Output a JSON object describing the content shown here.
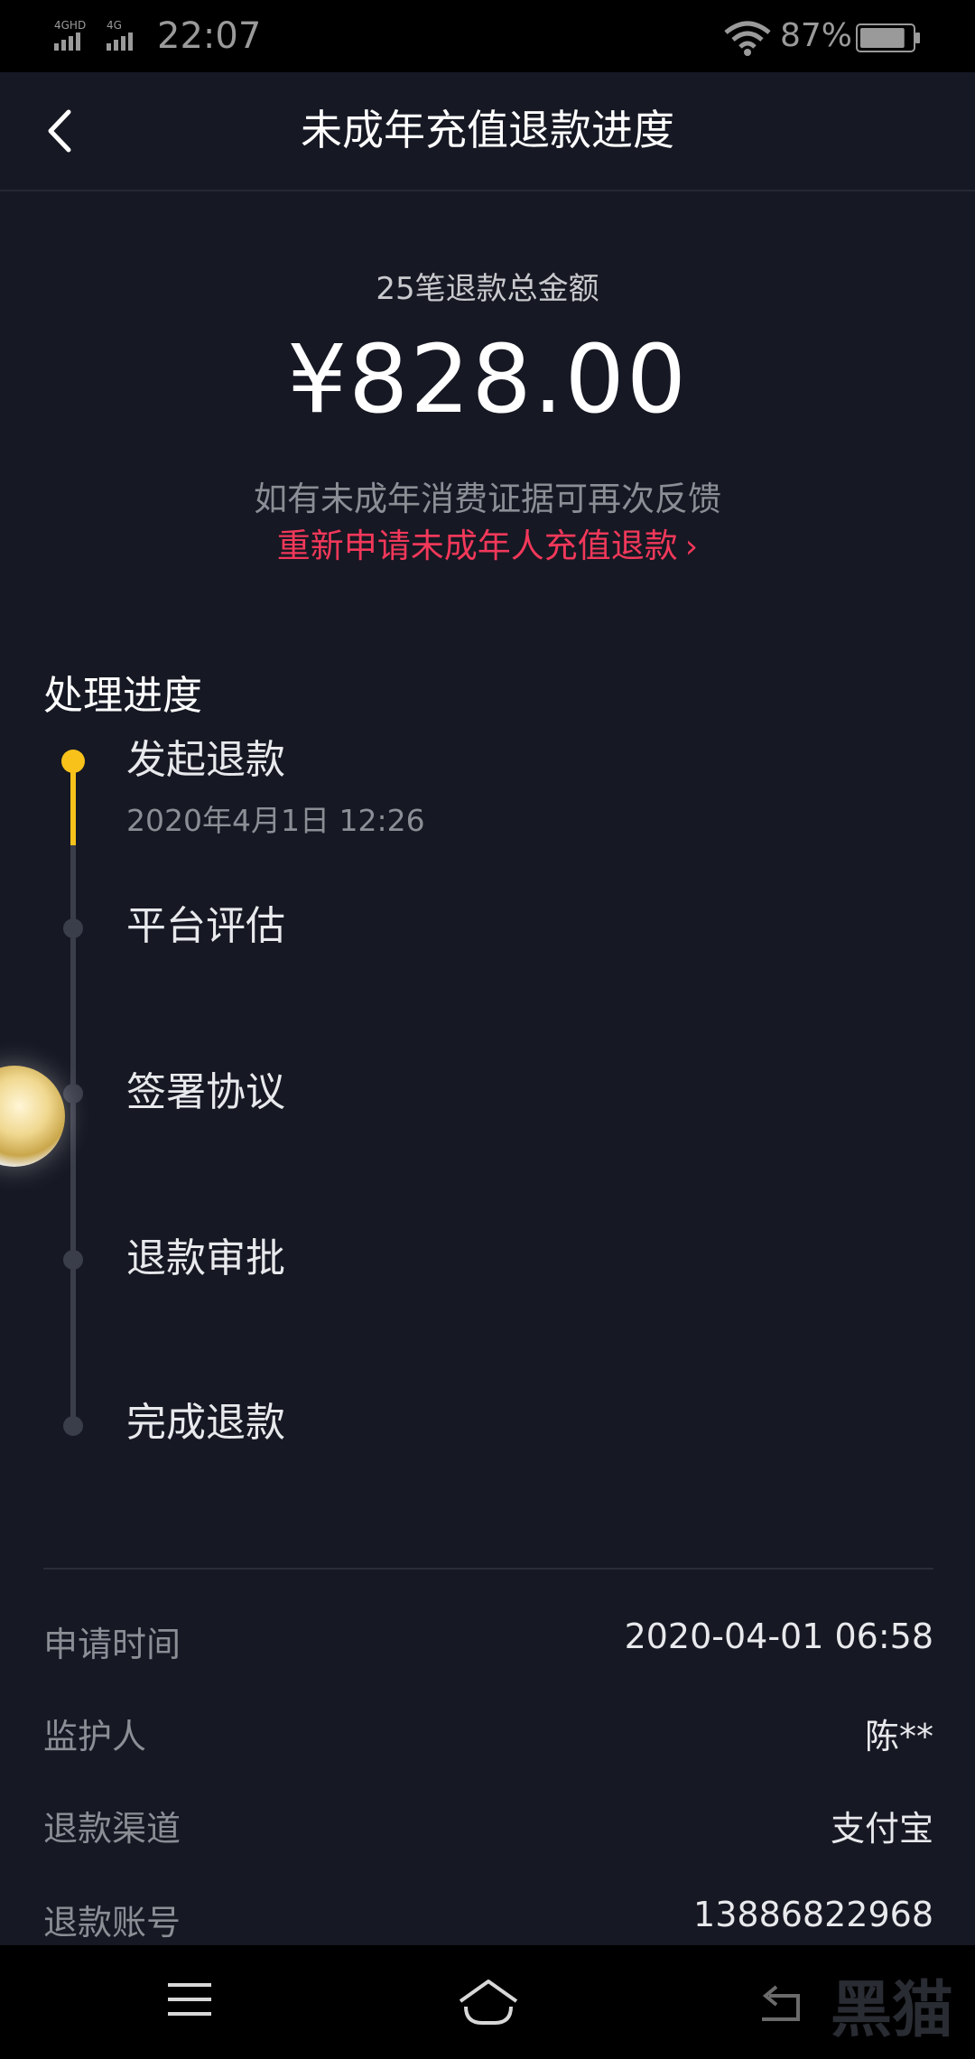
{
  "status_bar": {
    "network1": "4GHD",
    "network2": "4G",
    "time": "22:07",
    "battery_percent": "87%",
    "battery_level": 0.87
  },
  "header": {
    "title": "未成年充值退款进度",
    "back_icon": "chevron-left-icon"
  },
  "summary": {
    "label": "25笔退款总金额",
    "amount": "¥828.00",
    "note": "如有未成年消费证据可再次反馈",
    "reapply_link": "重新申请未成年人充值退款",
    "reapply_chevron": "›"
  },
  "progress": {
    "title": "处理进度",
    "steps": [
      {
        "label": "发起退款",
        "time": "2020年4月1日 12:26",
        "state": "done"
      },
      {
        "label": "平台评估",
        "state": "pending"
      },
      {
        "label": "签署协议",
        "state": "pending"
      },
      {
        "label": "退款审批",
        "state": "pending"
      },
      {
        "label": "完成退款",
        "state": "pending"
      }
    ],
    "active_color": "#f8c21b",
    "pending_color": "#3a3d4a"
  },
  "info": {
    "rows": [
      {
        "label": "申请时间",
        "value": "2020-04-01 06:58"
      },
      {
        "label": "监护人",
        "value": "陈**"
      },
      {
        "label": "退款渠道",
        "value": "支付宝"
      },
      {
        "label": "退款账号",
        "value": "13886822968"
      }
    ]
  },
  "nav": {
    "menu_icon": "menu-icon",
    "home_icon": "home-icon",
    "back_icon": "back-icon"
  },
  "watermark": "黑猫",
  "colors": {
    "background": "#161823",
    "accent_red": "#f2385a",
    "accent_yellow": "#f8c21b"
  }
}
